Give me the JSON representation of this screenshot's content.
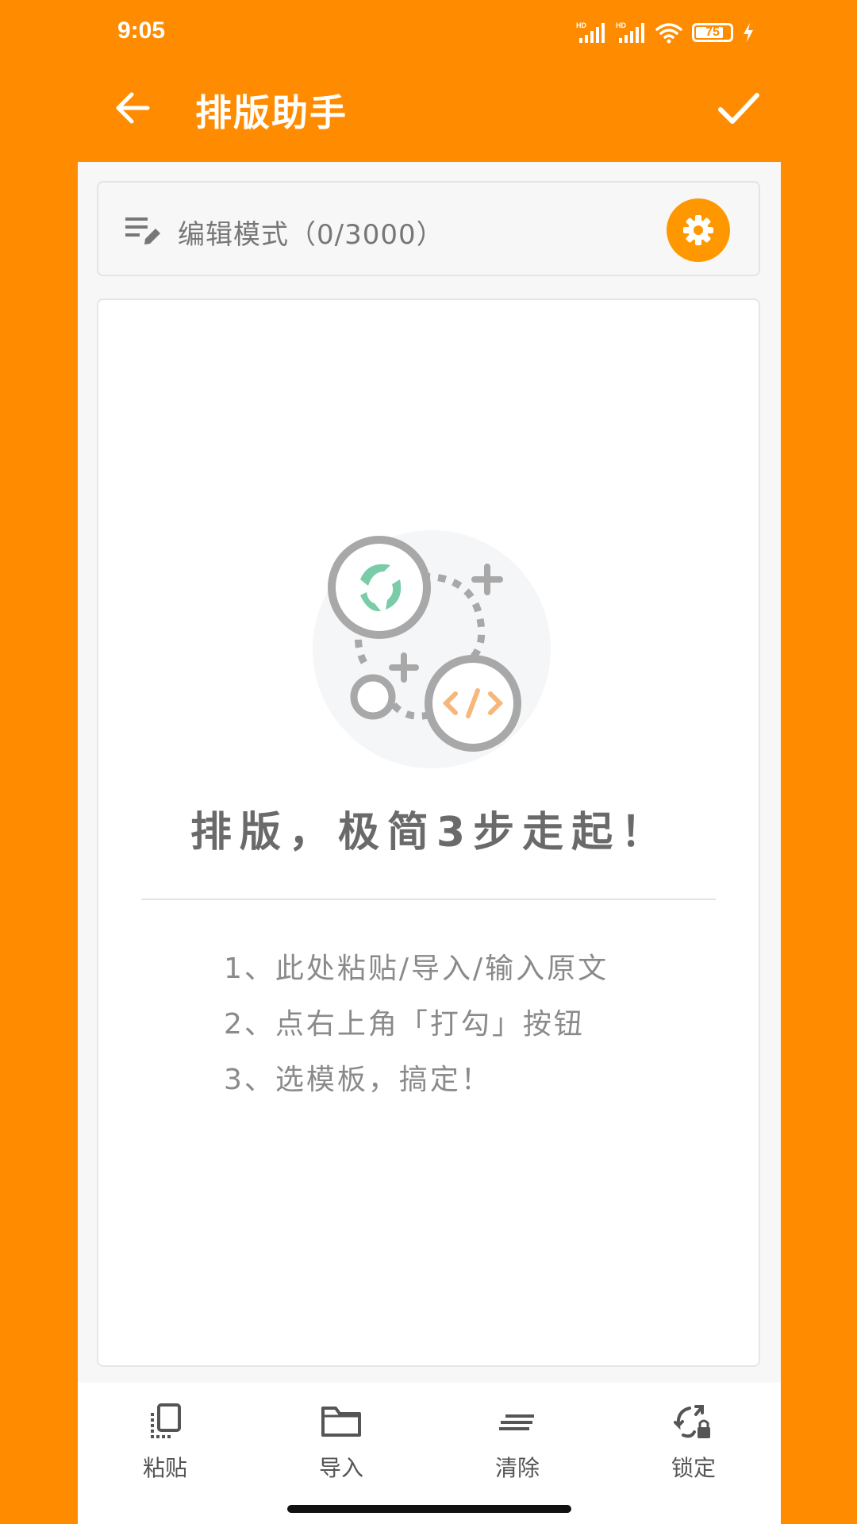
{
  "status_bar": {
    "time": "9:05",
    "battery": "75",
    "icons": [
      "hd-signal-icon",
      "hd-signal-icon",
      "wifi-icon",
      "battery-icon",
      "charging-icon"
    ]
  },
  "app_bar": {
    "title": "排版助手",
    "back_icon": "arrow-left-icon",
    "confirm_icon": "check-icon"
  },
  "mode_bar": {
    "label": "编辑模式（0/3000）",
    "edit_icon": "edit-notes-icon",
    "settings_icon": "gear-icon"
  },
  "placeholder": {
    "headline": "排版，极简3步走起！",
    "steps": [
      "1、此处粘贴/导入/输入原文",
      "2、点右上角「打勾」按钮",
      "3、选模板，搞定！"
    ]
  },
  "toolbar": {
    "items": [
      {
        "label": "粘贴",
        "icon": "paste-icon"
      },
      {
        "label": "导入",
        "icon": "folder-icon"
      },
      {
        "label": "清除",
        "icon": "clear-lines-icon"
      },
      {
        "label": "锁定",
        "icon": "rotation-lock-icon"
      }
    ]
  },
  "colors": {
    "accent": "#FF8C00",
    "settings_button": "#FF9800",
    "illustration_green": "#7ACBA8",
    "illustration_orange": "#F6B77A"
  }
}
